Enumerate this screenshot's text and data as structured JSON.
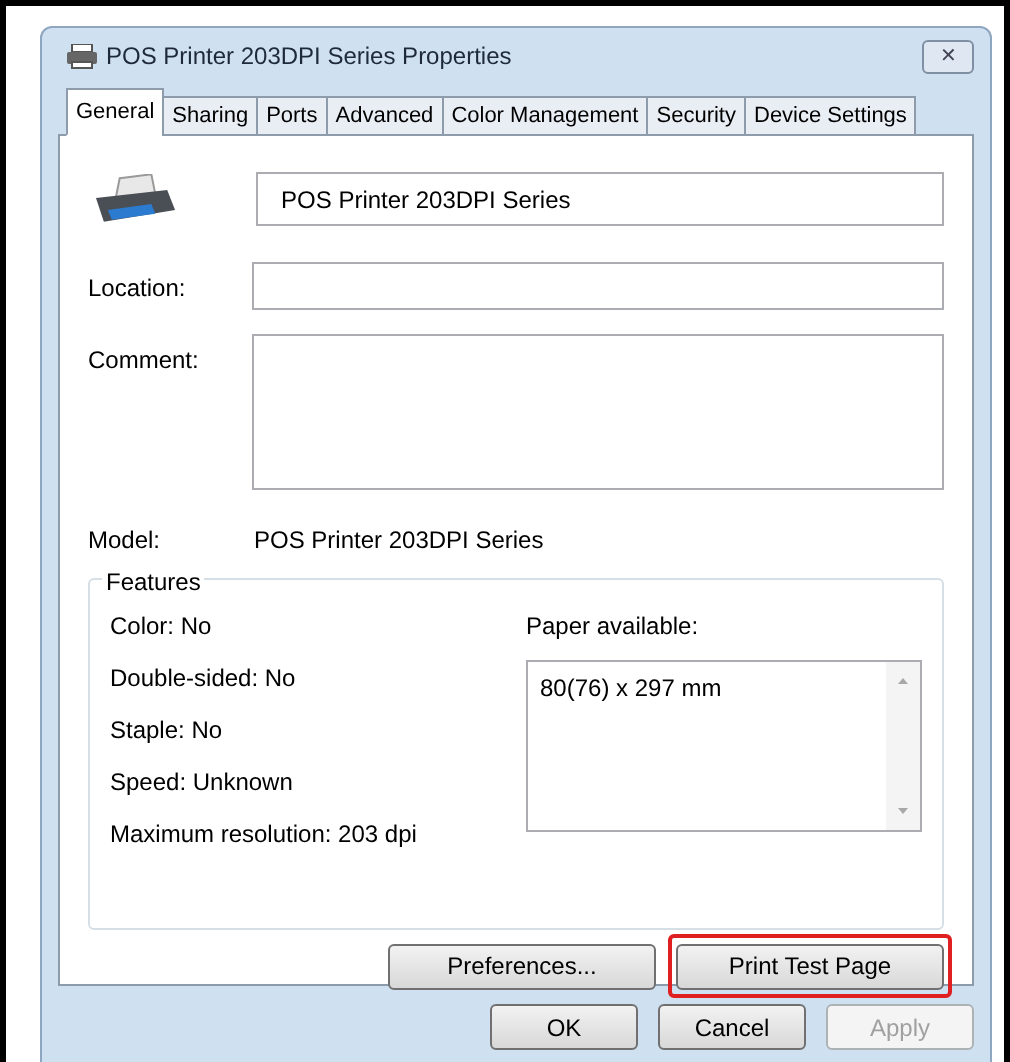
{
  "window": {
    "title": "POS Printer 203DPI  Series Properties",
    "close": "✕"
  },
  "tabs": [
    {
      "label": "General",
      "selected": true
    },
    {
      "label": "Sharing",
      "selected": false
    },
    {
      "label": "Ports",
      "selected": false
    },
    {
      "label": "Advanced",
      "selected": false
    },
    {
      "label": "Color Management",
      "selected": false
    },
    {
      "label": "Security",
      "selected": false
    },
    {
      "label": "Device Settings",
      "selected": false
    }
  ],
  "printer_name": "POS Printer 203DPI  Series",
  "fields": [
    {
      "label": "Location:",
      "kind": "line"
    },
    {
      "label": "Comment:",
      "kind": "area"
    }
  ],
  "model": {
    "label": "Model:",
    "value": "POS Printer 203DPI  Series"
  },
  "features": {
    "title": "Features",
    "items": [
      "Color: No",
      "Double-sided: No",
      "Staple: No",
      "Speed: Unknown",
      "Maximum resolution: 203 dpi"
    ],
    "paper_label": "Paper available:",
    "paper": [
      "80(76) x 297 mm"
    ]
  },
  "actions": [
    {
      "label": "Preferences...",
      "highlighted": false
    },
    {
      "label": "Print Test Page",
      "highlighted": true
    }
  ],
  "buttons": [
    {
      "label": "OK",
      "disabled": false
    },
    {
      "label": "Cancel",
      "disabled": false
    },
    {
      "label": "Apply",
      "disabled": true
    }
  ]
}
